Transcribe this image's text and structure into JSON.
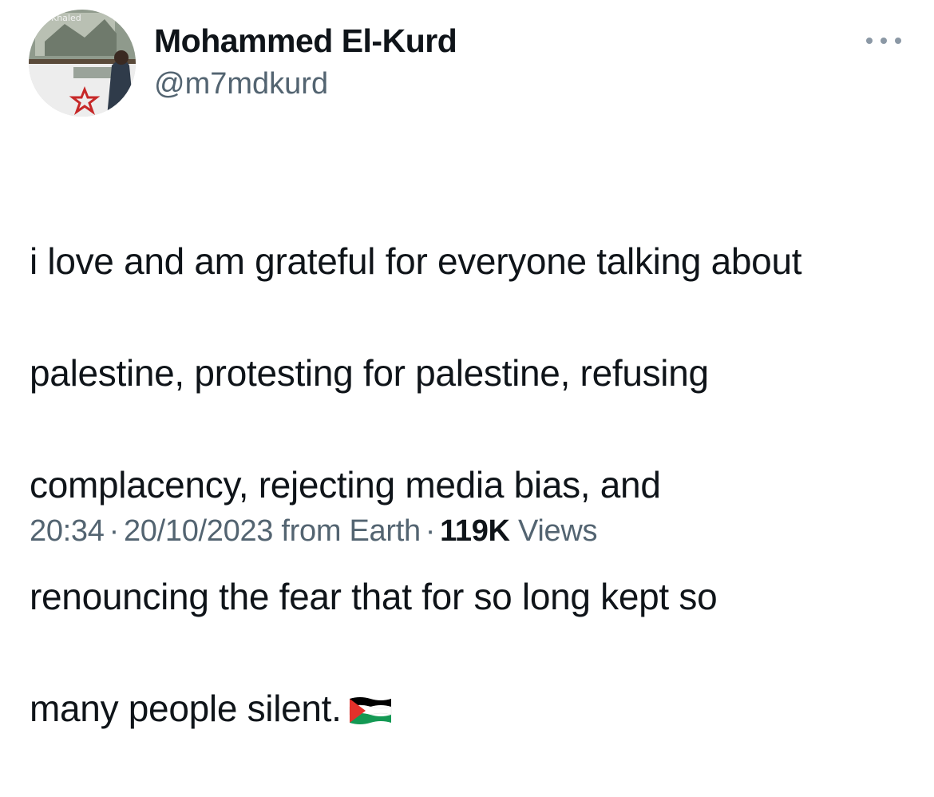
{
  "user": {
    "display_name": "Mohammed El-Kurd",
    "handle": "@m7mdkurd",
    "avatar_icon": "profile-photo"
  },
  "tweet": {
    "text_lines": [
      "i love and am grateful for everyone talking about",
      "palestine, protesting for palestine, refusing",
      "complacency, rejecting media bias, and",
      "renouncing the fear that for so long kept so",
      "many people silent."
    ],
    "emoji": "palestine-flag-emoji"
  },
  "meta": {
    "time": "20:34",
    "separator": "·",
    "date": "20/10/2023",
    "source": "from Earth",
    "views_count": "119K",
    "views_label": "Views"
  },
  "icons": {
    "more": "more-options-icon"
  },
  "colors": {
    "text_primary": "#0f1419",
    "text_secondary": "#536471",
    "more_icon": "#8b98a5",
    "flag_red": "#e4312b",
    "flag_green": "#149954",
    "flag_black": "#000000"
  }
}
